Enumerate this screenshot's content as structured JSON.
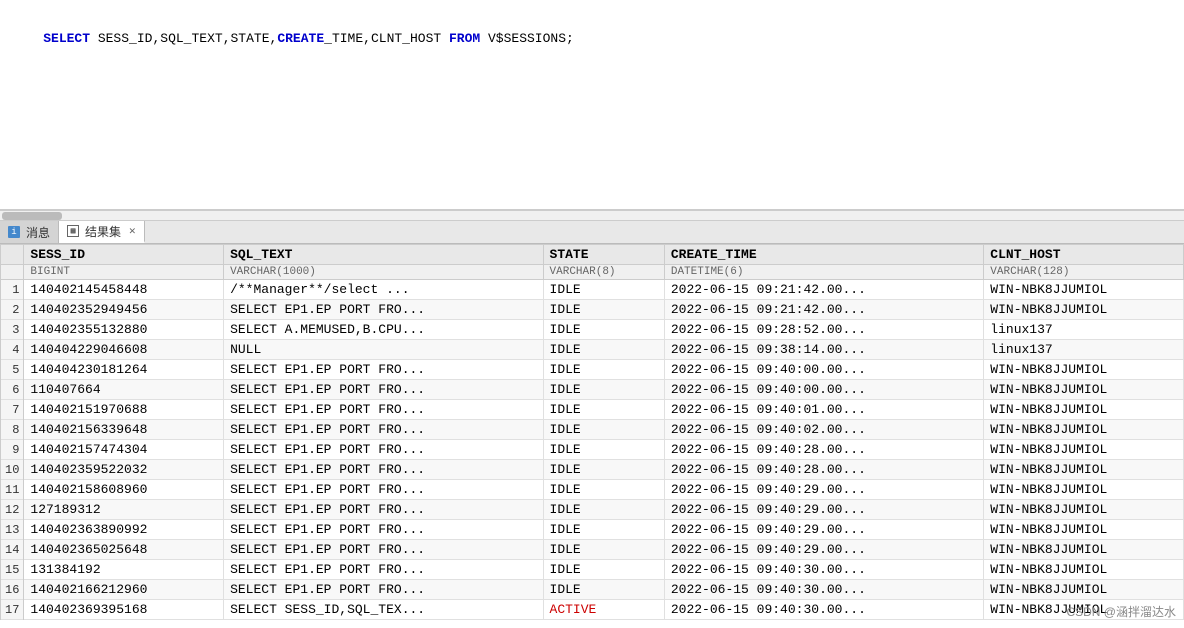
{
  "sql_editor": {
    "line1": "SELECT SESS_ID,SQL_TEXT,STATE,CREATE_TIME,CLNT_HOST FROM V$SESSIONS;"
  },
  "tabs": [
    {
      "id": "messages",
      "label": "消息",
      "active": false,
      "icon": "message"
    },
    {
      "id": "results",
      "label": "结果集",
      "active": true,
      "icon": "grid"
    }
  ],
  "table": {
    "columns": [
      {
        "name": "SESS_ID",
        "type": "BIGINT"
      },
      {
        "name": "SQL_TEXT",
        "type": "VARCHAR(1000)"
      },
      {
        "name": "STATE",
        "type": "VARCHAR(8)"
      },
      {
        "name": "CREATE_TIME",
        "type": "DATETIME(6)"
      },
      {
        "name": "CLNT_HOST",
        "type": "VARCHAR(128)"
      }
    ],
    "rows": [
      {
        "num": "1",
        "sess_id": "140402145458448",
        "sql_text": "/**Manager**/select ...",
        "state": "IDLE",
        "create_time": "2022-06-15 09:21:42.00...",
        "clnt_host": "WIN-NBK8JJUMIOL"
      },
      {
        "num": "2",
        "sess_id": "140402352949456",
        "sql_text": "SELECT EP1.EP PORT FRO...",
        "state": "IDLE",
        "create_time": "2022-06-15 09:21:42.00...",
        "clnt_host": "WIN-NBK8JJUMIOL"
      },
      {
        "num": "3",
        "sess_id": "140402355132880",
        "sql_text": "SELECT A.MEMUSED,B.CPU...",
        "state": "IDLE",
        "create_time": "2022-06-15 09:28:52.00...",
        "clnt_host": "linux137"
      },
      {
        "num": "4",
        "sess_id": "140404229046608",
        "sql_text": "NULL",
        "state": "IDLE",
        "create_time": "2022-06-15 09:38:14.00...",
        "clnt_host": "linux137"
      },
      {
        "num": "5",
        "sess_id": "140404230181264",
        "sql_text": "SELECT EP1.EP PORT FRO...",
        "state": "IDLE",
        "create_time": "2022-06-15 09:40:00.00...",
        "clnt_host": "WIN-NBK8JJUMIOL"
      },
      {
        "num": "6",
        "sess_id": "110407664",
        "sql_text": "SELECT EP1.EP PORT FRO...",
        "state": "IDLE",
        "create_time": "2022-06-15 09:40:00.00...",
        "clnt_host": "WIN-NBK8JJUMIOL"
      },
      {
        "num": "7",
        "sess_id": "140402151970688",
        "sql_text": "SELECT EP1.EP PORT FRO...",
        "state": "IDLE",
        "create_time": "2022-06-15 09:40:01.00...",
        "clnt_host": "WIN-NBK8JJUMIOL"
      },
      {
        "num": "8",
        "sess_id": "140402156339648",
        "sql_text": "SELECT EP1.EP PORT FRO...",
        "state": "IDLE",
        "create_time": "2022-06-15 09:40:02.00...",
        "clnt_host": "WIN-NBK8JJUMIOL"
      },
      {
        "num": "9",
        "sess_id": "140402157474304",
        "sql_text": "SELECT EP1.EP PORT FRO...",
        "state": "IDLE",
        "create_time": "2022-06-15 09:40:28.00...",
        "clnt_host": "WIN-NBK8JJUMIOL"
      },
      {
        "num": "10",
        "sess_id": "140402359522032",
        "sql_text": "SELECT EP1.EP PORT FRO...",
        "state": "IDLE",
        "create_time": "2022-06-15 09:40:28.00...",
        "clnt_host": "WIN-NBK8JJUMIOL"
      },
      {
        "num": "11",
        "sess_id": "140402158608960",
        "sql_text": "SELECT EP1.EP PORT FRO...",
        "state": "IDLE",
        "create_time": "2022-06-15 09:40:29.00...",
        "clnt_host": "WIN-NBK8JJUMIOL"
      },
      {
        "num": "12",
        "sess_id": "127189312",
        "sql_text": "SELECT EP1.EP PORT FRO...",
        "state": "IDLE",
        "create_time": "2022-06-15 09:40:29.00...",
        "clnt_host": "WIN-NBK8JJUMIOL"
      },
      {
        "num": "13",
        "sess_id": "140402363890992",
        "sql_text": "SELECT EP1.EP PORT FRO...",
        "state": "IDLE",
        "create_time": "2022-06-15 09:40:29.00...",
        "clnt_host": "WIN-NBK8JJUMIOL"
      },
      {
        "num": "14",
        "sess_id": "140402365025648",
        "sql_text": "SELECT EP1.EP PORT FRO...",
        "state": "IDLE",
        "create_time": "2022-06-15 09:40:29.00...",
        "clnt_host": "WIN-NBK8JJUMIOL"
      },
      {
        "num": "15",
        "sess_id": "131384192",
        "sql_text": "SELECT EP1.EP PORT FRO...",
        "state": "IDLE",
        "create_time": "2022-06-15 09:40:30.00...",
        "clnt_host": "WIN-NBK8JJUMIOL"
      },
      {
        "num": "16",
        "sess_id": "140402166212960",
        "sql_text": "SELECT EP1.EP PORT FRO...",
        "state": "IDLE",
        "create_time": "2022-06-15 09:40:30.00...",
        "clnt_host": "WIN-NBK8JJUMIOL"
      },
      {
        "num": "17",
        "sess_id": "140402369395168",
        "sql_text": "SELECT SESS_ID,SQL_TEX...",
        "state": "ACTIVE",
        "create_time": "2022-06-15 09:40:30.00...",
        "clnt_host": "WIN-NBK8JJUMIOL"
      }
    ]
  },
  "watermark": "CSDN @涵拌溜达水"
}
